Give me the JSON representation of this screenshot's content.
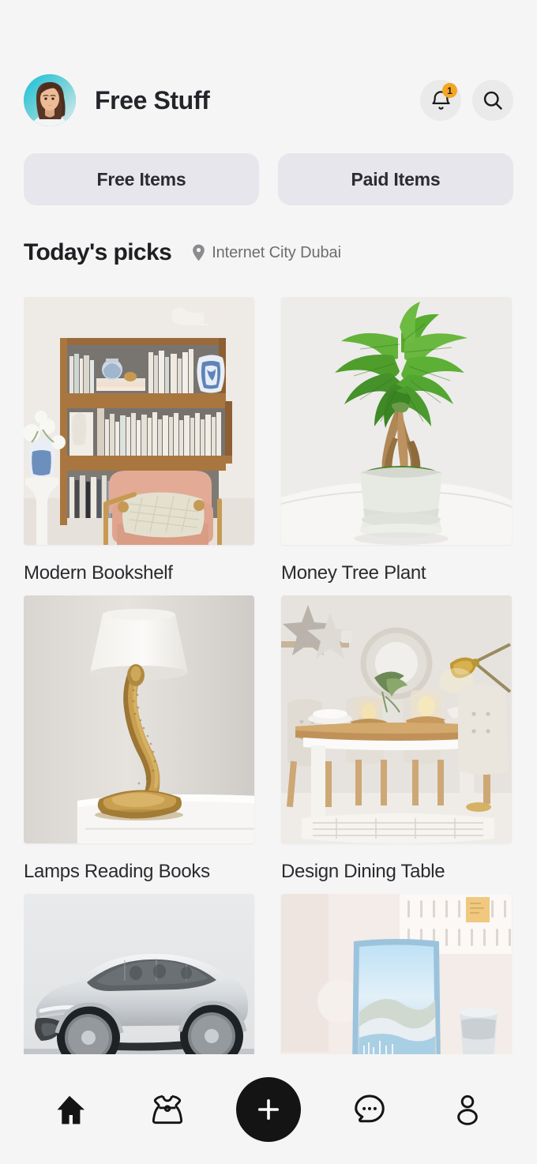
{
  "header": {
    "title": "Free Stuff",
    "avatar_alt": "user-avatar",
    "notification_badge": "1",
    "notification_icon": "bell-icon",
    "search_icon": "search-icon"
  },
  "tabs": [
    {
      "label": "Free Items"
    },
    {
      "label": "Paid Items"
    }
  ],
  "section": {
    "title": "Today's picks",
    "location_icon": "location-pin-icon",
    "location": "Internet City Dubai"
  },
  "items": [
    {
      "title": "Modern Bookshelf",
      "image": "bookshelf-photo"
    },
    {
      "title": "Money Tree Plant",
      "image": "money-tree-photo"
    },
    {
      "title": "Lamps Reading Books",
      "image": "snake-lamp-photo"
    },
    {
      "title": "Design Dining Table",
      "image": "dining-table-photo"
    },
    {
      "title": "",
      "image": "concept-car-photo"
    },
    {
      "title": "",
      "image": "laptop-desk-photo"
    }
  ],
  "bottom_nav": [
    {
      "name": "home",
      "icon": "home-icon",
      "active": true
    },
    {
      "name": "clothing",
      "icon": "dress-icon",
      "active": false
    },
    {
      "name": "add",
      "icon": "plus-icon",
      "active": false
    },
    {
      "name": "messages",
      "icon": "chat-bubble-icon",
      "active": false
    },
    {
      "name": "profile",
      "icon": "person-icon",
      "active": false
    }
  ],
  "colors": {
    "background": "#f5f5f5",
    "tab_bg": "#e6e6ec",
    "icon_btn_bg": "#eaeaea",
    "badge": "#f5a623",
    "fab": "#141414",
    "text_primary": "#24252a",
    "text_muted": "#6d6e72"
  }
}
